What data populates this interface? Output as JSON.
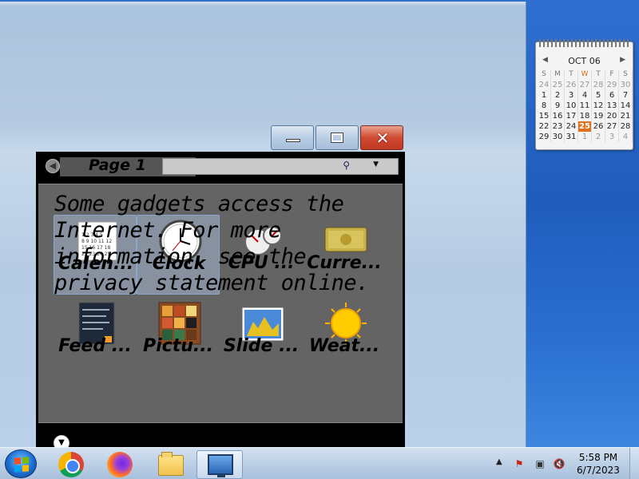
{
  "calendar": {
    "month_label": "OCT 06",
    "weekdays": [
      "S",
      "M",
      "T",
      "W",
      "T",
      "F",
      "S"
    ],
    "weeks": [
      [
        "24",
        "25",
        "26",
        "27",
        "28",
        "29",
        "30"
      ],
      [
        "1",
        "2",
        "3",
        "4",
        "5",
        "6",
        "7"
      ],
      [
        "8",
        "9",
        "10",
        "11",
        "12",
        "13",
        "14"
      ],
      [
        "15",
        "16",
        "17",
        "18",
        "19",
        "20",
        "21"
      ],
      [
        "22",
        "23",
        "24",
        "25",
        "26",
        "27",
        "28"
      ],
      [
        "29",
        "30",
        "31",
        "1",
        "2",
        "3",
        "4"
      ]
    ],
    "today": "25",
    "accent_color": "#e0711c"
  },
  "gallery": {
    "page_label": "Page 1",
    "notice": "Some gadgets access the Internet.  For more information, see the privacy statement online.",
    "gadgets": [
      {
        "name": "Calen...",
        "icon": "calendar-icon",
        "selected": true
      },
      {
        "name": "Clock",
        "icon": "clock-icon",
        "selected": true
      },
      {
        "name": "CPU ...",
        "icon": "cpu-meter-icon",
        "selected": false
      },
      {
        "name": "Curre...",
        "icon": "currency-icon",
        "selected": false
      },
      {
        "name": "Feed ...",
        "icon": "feed-headlines-icon",
        "selected": false
      },
      {
        "name": "Pictu...",
        "icon": "picture-puzzle-icon",
        "selected": false
      },
      {
        "name": "Slide ...",
        "icon": "slide-show-icon",
        "selected": false
      },
      {
        "name": "Weat...",
        "icon": "weather-icon",
        "selected": false
      }
    ]
  },
  "window_buttons": {
    "minimize": "minimize-icon",
    "maximize": "maximize-icon",
    "close": "close-icon"
  },
  "taskbar": {
    "pinned": [
      "start-orb-icon",
      "chrome-icon",
      "firefox-icon",
      "file-explorer-icon",
      "desktop-gadgets-icon"
    ],
    "clock": {
      "time": "5:58 PM",
      "date": "6/7/2023"
    }
  }
}
